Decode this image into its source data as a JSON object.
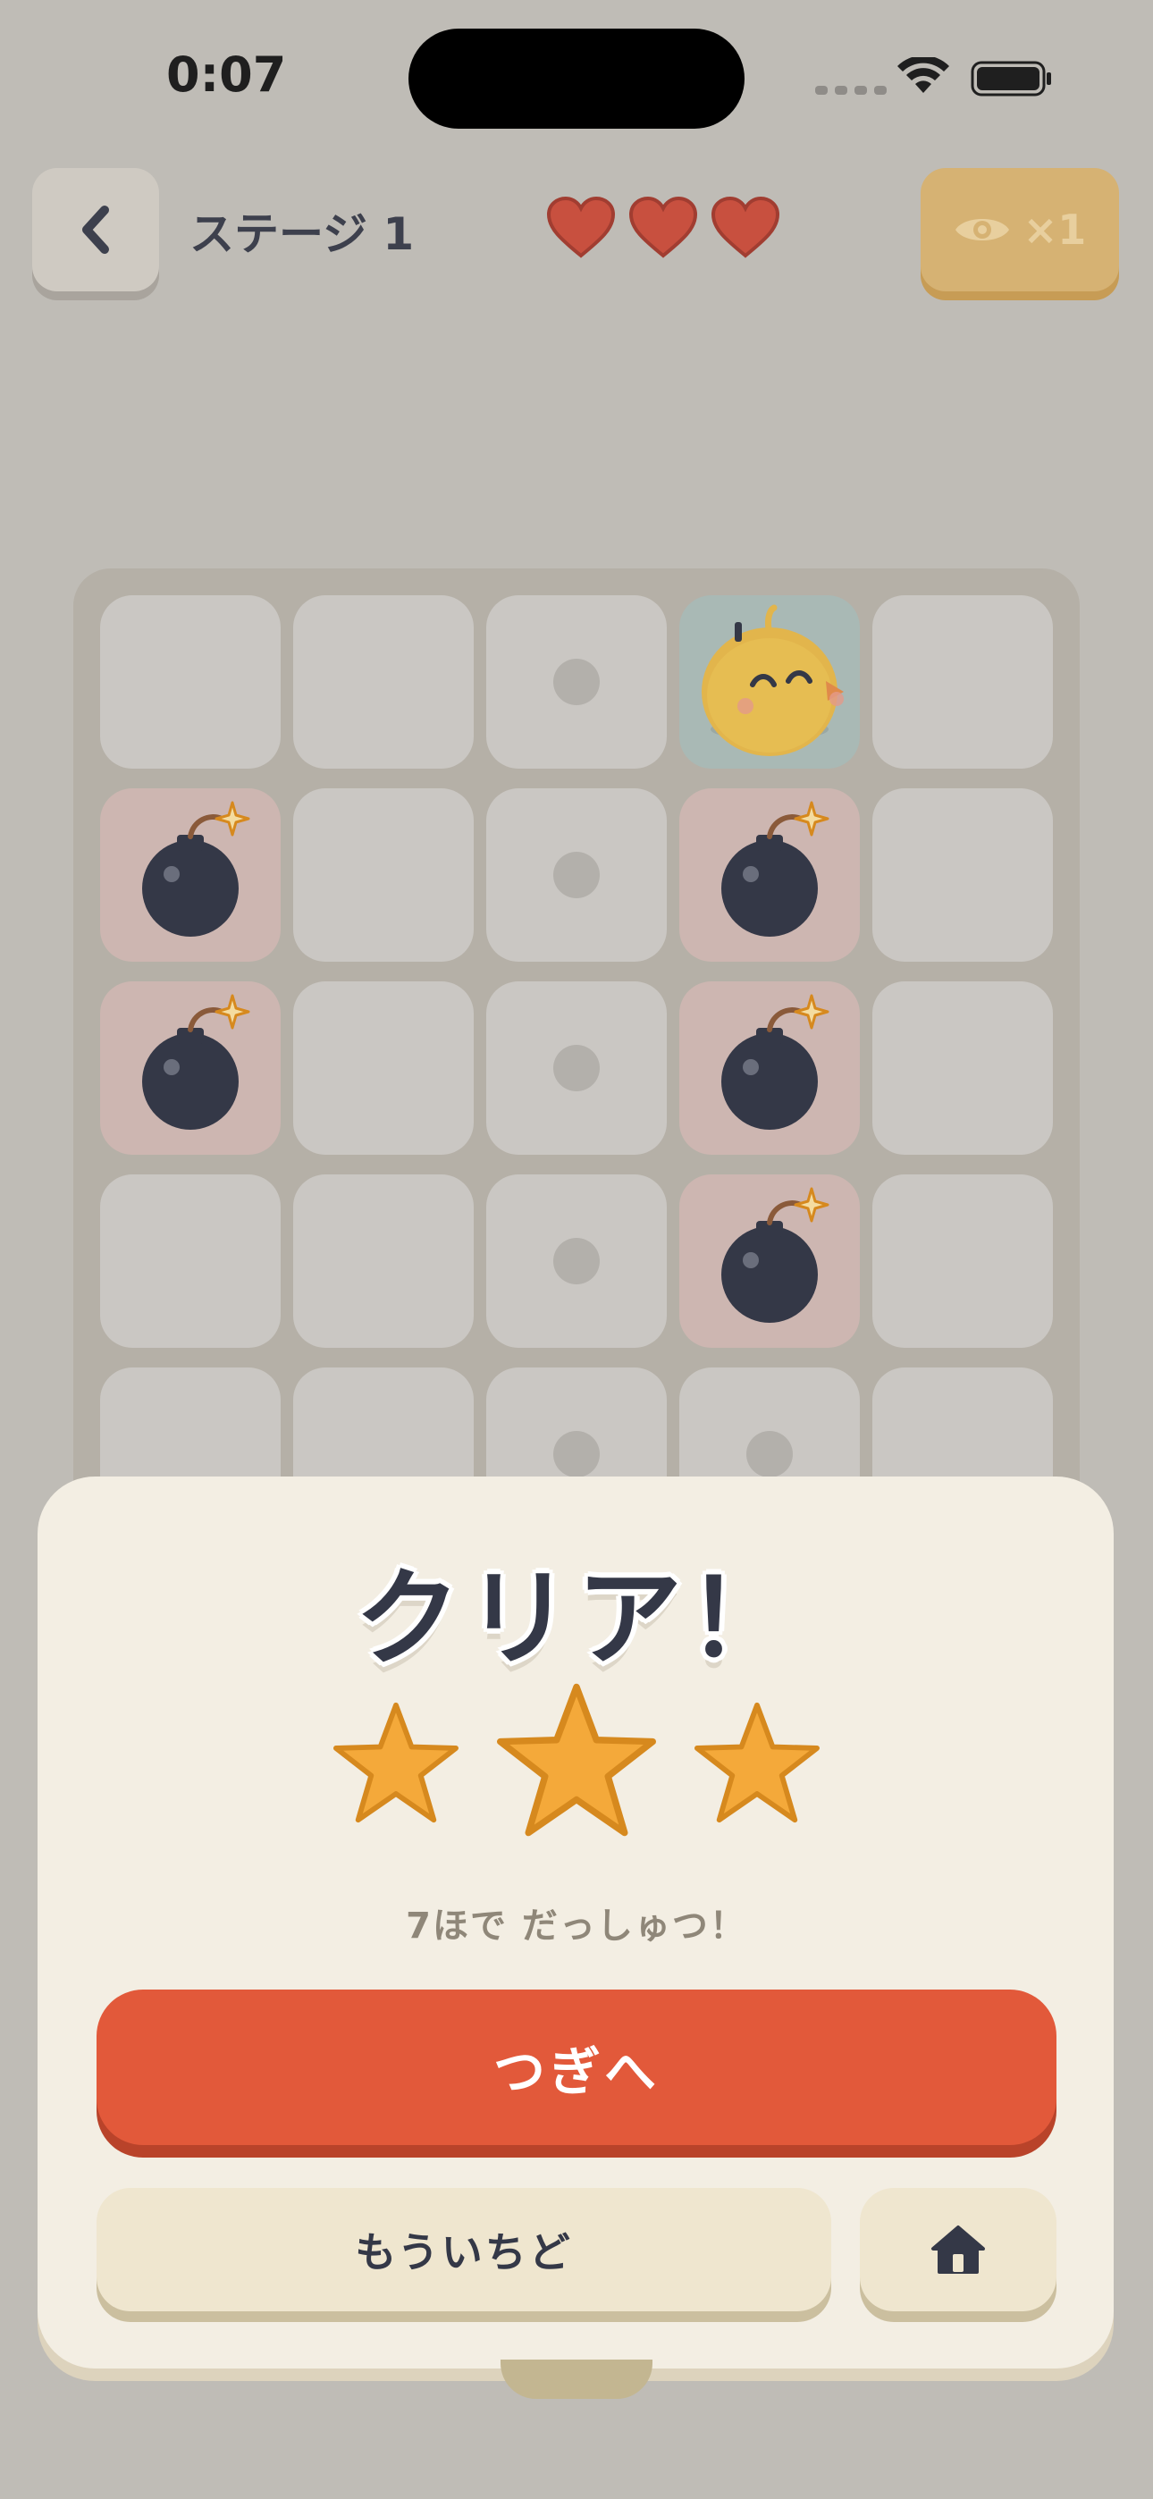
{
  "status_bar": {
    "time": "0:07",
    "wifi_icon": "wifi-icon",
    "battery_icon": "battery-icon"
  },
  "header": {
    "back_icon": "chevron-left-icon",
    "stage_title": "ステージ 1",
    "lives": 3,
    "hint_icon": "eye-icon",
    "hint_count": "×1"
  },
  "board": {
    "rows": [
      [
        "empty",
        "empty",
        "dot",
        "player",
        "empty"
      ],
      [
        "bomb",
        "empty",
        "dot",
        "bomb",
        "empty"
      ],
      [
        "bomb",
        "empty",
        "dot",
        "bomb",
        "empty"
      ],
      [
        "empty",
        "empty",
        "dot",
        "bomb",
        "empty"
      ],
      [
        "empty",
        "empty",
        "dot",
        "dot",
        "empty"
      ]
    ]
  },
  "result": {
    "title": "クリア！",
    "stars_earned": 3,
    "stars_total": 3,
    "message": "7ほで だっしゅつ！",
    "next_label": "つぎへ",
    "retry_label": "もういちど",
    "home_icon": "home-icon"
  },
  "colors": {
    "background": "#bfbcb6",
    "accent": "#e2593a",
    "star": "#f4a93a",
    "heart": "#c8503f",
    "card": "#f3eee3"
  }
}
